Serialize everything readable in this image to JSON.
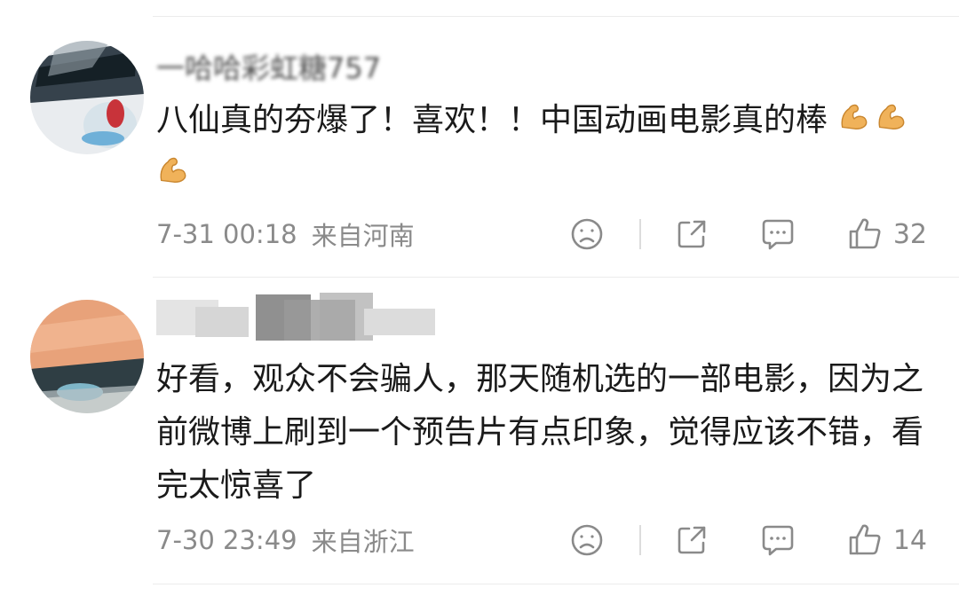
{
  "comments": [
    {
      "username": "一哈哈彩虹糖757",
      "text": "八仙真的夯爆了！喜欢！！中国动画电影真的棒",
      "emojis": [
        "flexed-biceps",
        "flexed-biceps",
        "flexed-biceps"
      ],
      "time": "7-31 00:18",
      "location": "来自河南",
      "likes": "32"
    },
    {
      "username": "",
      "text": "好看，观众不会骗人，那天随机选的一部电影，因为之前微博上刷到一个预告片有点印象，觉得应该不错，看完太惊喜了",
      "emojis": [],
      "time": "7-30 23:49",
      "location": "来自浙江",
      "likes": "14"
    }
  ],
  "icons": {
    "dislike": "sad-face-icon",
    "share": "share-icon",
    "reply": "comment-bubble-icon",
    "like": "thumbs-up-icon"
  },
  "colors": {
    "text": "#1a1a1a",
    "meta": "#8a8a8a",
    "divider": "#ececec"
  }
}
